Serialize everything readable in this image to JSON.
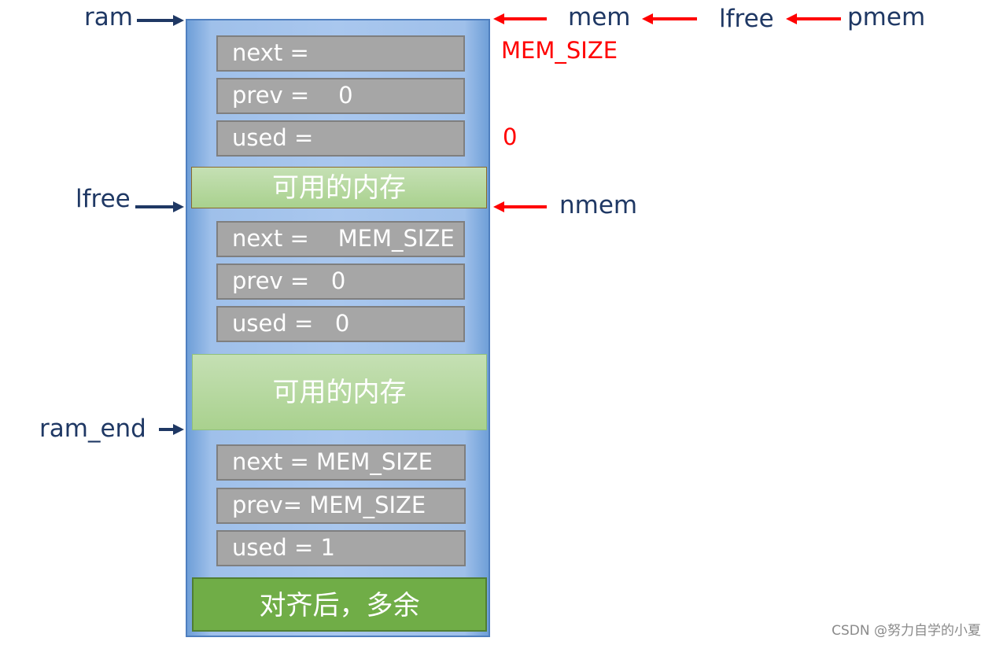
{
  "pointers_left": {
    "ram": "ram",
    "lfree": "lfree",
    "ram_end": "ram_end"
  },
  "pointers_right": {
    "mem": "mem",
    "lfree": "lfree",
    "pmem": "pmem",
    "nmem": "nmem"
  },
  "annotations": {
    "mem_next_value": "MEM_SIZE",
    "mem_used_value": "0"
  },
  "blocks": {
    "first_header": {
      "next": "next = ",
      "prev": "prev =    0",
      "used": "used = "
    },
    "available_memory_1": "可用的内存",
    "second_header": {
      "next": "next =    MEM_SIZE",
      "prev": "prev =   0",
      "used": "used =   0"
    },
    "available_memory_2": "可用的内存",
    "end_header": {
      "next": "next = MEM_SIZE",
      "prev": "prev= MEM_SIZE",
      "used": "used = 1"
    },
    "alignment_remainder": "对齐后，多余"
  },
  "colors": {
    "pointer_dark": "#1f3864",
    "pointer_red": "#ff0000",
    "field_gray": "#a6a6a6",
    "green_light": "#a9d18e",
    "green_dark": "#70ad47",
    "ram_blue": "#a9c7ee"
  },
  "watermark": "CSDN @努力自学的小夏"
}
